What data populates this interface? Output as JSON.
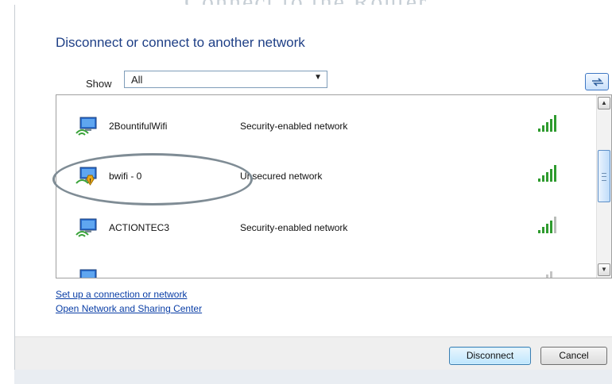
{
  "dialog": {
    "heading": "Disconnect or connect to another network",
    "show_label": "Show",
    "filter_value": "All"
  },
  "networks": [
    {
      "name": "2BountifulWifi",
      "status": "Security-enabled network",
      "secured": true,
      "signal_bars": 5
    },
    {
      "name": "bwifi - 0",
      "status": "Unsecured network",
      "secured": false,
      "signal_bars": 5,
      "highlighted": true
    },
    {
      "name": "ACTIONTEC3",
      "status": "Security-enabled network",
      "secured": true,
      "signal_bars": 4
    }
  ],
  "links": {
    "setup": "Set up a connection or network",
    "sharing_center": "Open Network and Sharing Center"
  },
  "buttons": {
    "disconnect": "Disconnect",
    "cancel": "Cancel"
  },
  "colors": {
    "heading": "#1e3f86",
    "link": "#0a3ea6",
    "signal": "#2f9b2f",
    "annotation_ellipse": "#7f8c95"
  }
}
